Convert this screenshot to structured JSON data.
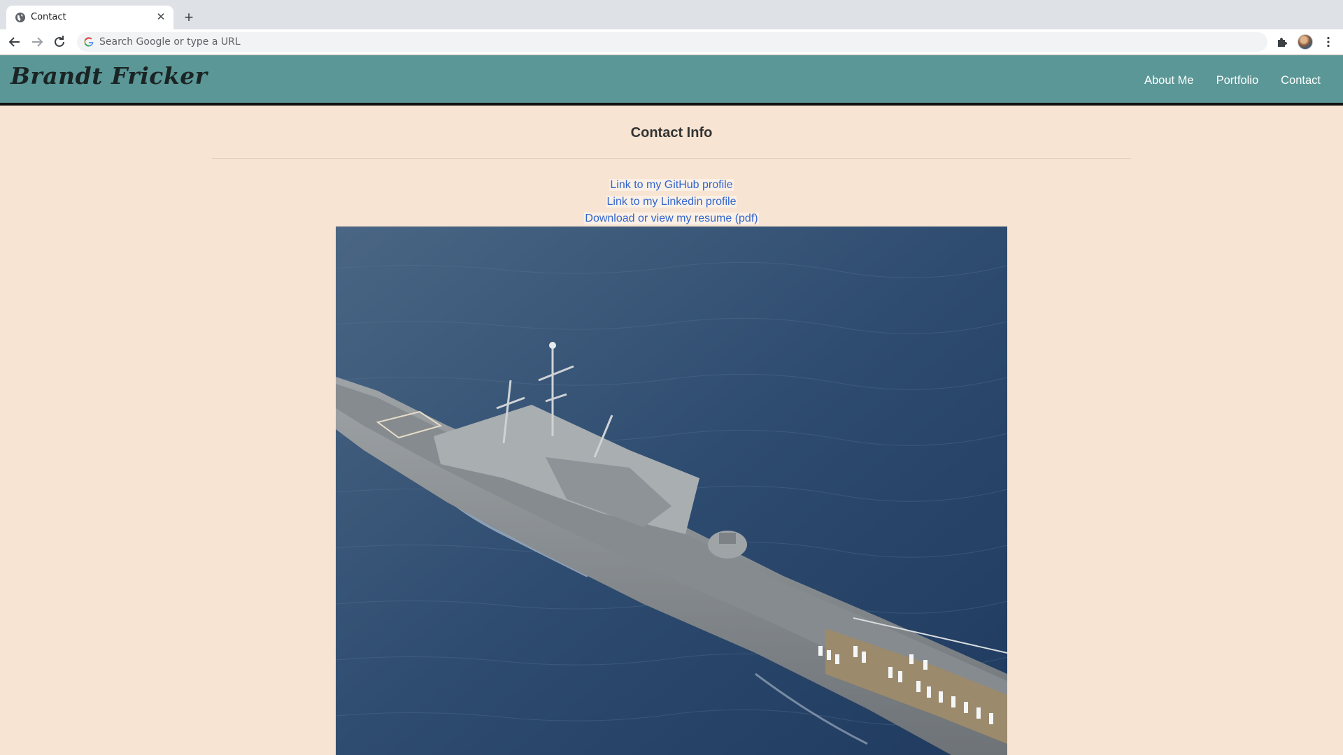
{
  "browser": {
    "tab_title": "Contact",
    "close_glyph": "✕",
    "new_tab_glyph": "+",
    "omnibox_placeholder": "Search Google or type a URL"
  },
  "site": {
    "logo": "Brandt Fricker",
    "nav": [
      "About Me",
      "Portfolio",
      "Contact"
    ],
    "header_color": "#5b9797",
    "page_background": "#f8e4d2"
  },
  "content": {
    "title": "Contact Info",
    "links": [
      "Link to my GitHub profile",
      "Link to my Linkedin profile",
      "Download or view my resume (pdf)"
    ],
    "link_color": "#3366cc"
  },
  "icons": {
    "tab_favicon": "globe-icon",
    "back": "back-arrow-icon",
    "forward": "forward-arrow-icon",
    "reload": "reload-icon",
    "omnibox": "google-g-icon",
    "extensions": "puzzle-piece-icon",
    "menu": "kebab-menu-icon"
  },
  "image": {
    "subject": "ship"
  }
}
